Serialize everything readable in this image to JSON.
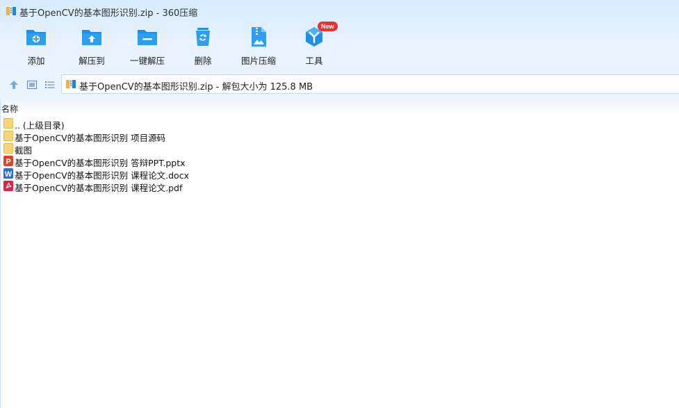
{
  "window": {
    "title": "基于OpenCV的基本图形识别.zip - 360压缩"
  },
  "toolbar": {
    "buttons": [
      {
        "label": "添加",
        "icon": "add-folder-icon"
      },
      {
        "label": "解压到",
        "icon": "extract-to-icon"
      },
      {
        "label": "一键解压",
        "icon": "one-click-extract-icon"
      },
      {
        "label": "删除",
        "icon": "recycle-bin-icon"
      },
      {
        "label": "图片压缩",
        "icon": "image-compress-icon"
      },
      {
        "label": "工具",
        "icon": "tools-icon",
        "badge": "New"
      }
    ]
  },
  "nav": {
    "up_icon": "up-arrow-icon",
    "thumbnail_view_icon": "thumbnail-view-icon",
    "list_view_icon": "list-view-icon",
    "address": "基于OpenCV的基本图形识别.zip - 解包大小为 125.8 MB"
  },
  "list": {
    "column_name": "名称",
    "items": [
      {
        "name": ".. (上级目录)",
        "type": "folder"
      },
      {
        "name": "基于OpenCV的基本图形识别 项目源码",
        "type": "folder"
      },
      {
        "name": "截图",
        "type": "folder"
      },
      {
        "name": "基于OpenCV的基本图形识别 答辩PPT.pptx",
        "type": "pptx"
      },
      {
        "name": "基于OpenCV的基本图形识别 课程论文.docx",
        "type": "docx"
      },
      {
        "name": "基于OpenCV的基本图形识别 课程论文.pdf",
        "type": "pdf"
      }
    ]
  },
  "colors": {
    "accent_blue": "#1e8fe6",
    "folder_yellow": "#f7d57a",
    "pptx_red": "#d9452b",
    "docx_blue": "#2f6fd6",
    "pdf_red": "#d8264a",
    "badge_red": "#e8322f"
  }
}
